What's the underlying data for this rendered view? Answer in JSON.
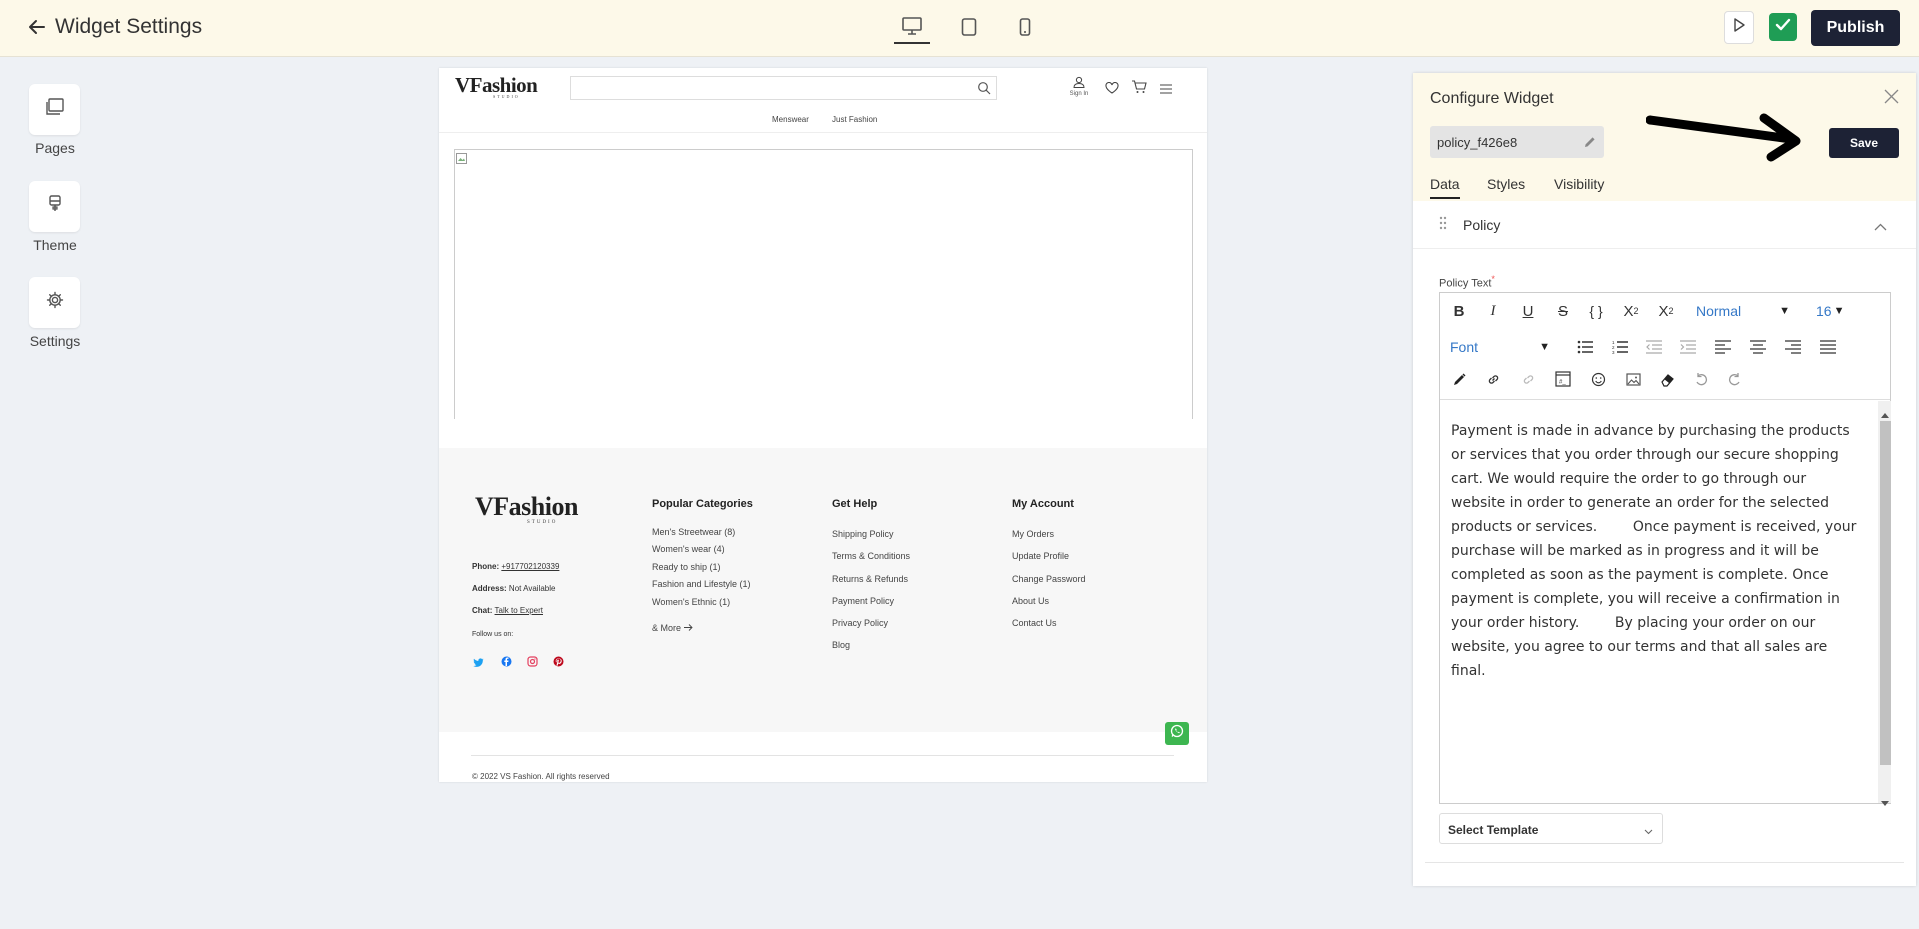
{
  "header": {
    "back_icon": "arrow-left-icon",
    "title": "Widget Settings",
    "devices": [
      "desktop-icon",
      "tablet-icon",
      "mobile-icon"
    ],
    "publish_label": "Publish"
  },
  "rail": {
    "items": [
      {
        "label": "Pages",
        "icon": "pages-icon"
      },
      {
        "label": "Theme",
        "icon": "brush-icon"
      },
      {
        "label": "Settings",
        "icon": "gear-icon"
      }
    ]
  },
  "preview": {
    "logo_main": "VFashion",
    "logo_sub": "STUDIO",
    "sign_in": "Sign In",
    "nav": [
      "Menswear",
      "Just Fashion"
    ],
    "footer": {
      "phone_label": "Phone:",
      "phone_value": "+917702120339",
      "address_label": "Address:",
      "address_value": "Not Available",
      "chat_label": "Chat:",
      "chat_value": "Talk to Expert",
      "follow": "Follow us on:",
      "col1_title": "Popular Categories",
      "col1_items": [
        "Men's Streetwear (8)",
        "Women's wear (4)",
        "Ready to ship (1)",
        "Fashion and Lifestyle (1)",
        "Women's Ethnic (1)"
      ],
      "col1_more": "& More",
      "col2_title": "Get Help",
      "col2_items": [
        "Shipping Policy",
        "Terms & Conditions",
        "Returns & Refunds",
        "Payment Policy",
        "Privacy Policy",
        "Blog"
      ],
      "col3_title": "My Account",
      "col3_items": [
        "My Orders",
        "Update Profile",
        "Change Password",
        "About Us",
        "Contact Us"
      ],
      "copyright": "© 2022 VS Fashion. All rights reserved"
    }
  },
  "panel": {
    "title": "Configure Widget",
    "widget_name": "policy_f426e8",
    "save_label": "Save",
    "tabs": [
      "Data",
      "Styles",
      "Visibility"
    ],
    "section_title": "Policy",
    "field_label": "Policy Text",
    "toolbar": {
      "block_format": "Normal",
      "font_size": "16",
      "font_family": "Font"
    },
    "policy_text": "Payment is made in advance by purchasing the products or services that you order through our secure shopping cart. We would require the order to go through our website in order to generate an order for the selected products or services.        Once payment is received, your purchase will be marked as in progress and it will be completed as soon as the payment is complete. Once payment is complete, you will receive a confirmation in your order history.        By placing your order on our website, you agree to our terms and that all sales are final.",
    "template_placeholder": "Select Template"
  },
  "colors": {
    "topbar_bg": "#fdf9e9",
    "dark_button": "#1d2235",
    "check_green": "#1f9d55",
    "whatsapp_green": "#3db650"
  }
}
